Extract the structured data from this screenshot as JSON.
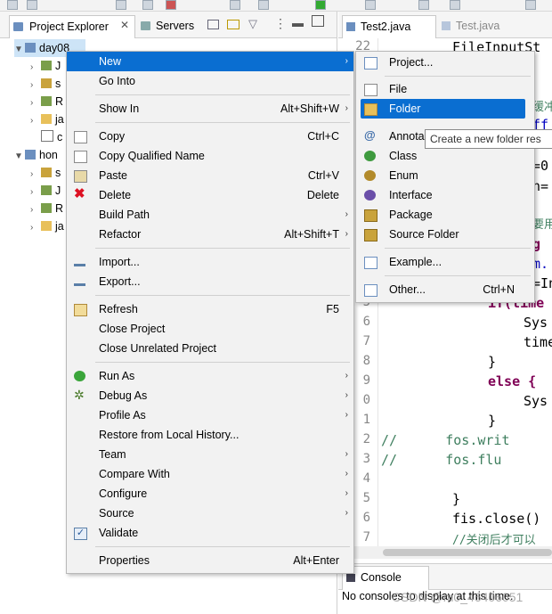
{
  "left_tabs": {
    "project_explorer": "Project Explorer",
    "servers": "Servers"
  },
  "tree": {
    "day08": "day08",
    "day08_children": [
      "J",
      "s",
      "R",
      "ja",
      "c"
    ],
    "hon": "hon",
    "hon_children": [
      "s",
      "J",
      "R",
      "ja"
    ]
  },
  "editor_tabs": {
    "active": "Test2.java",
    "inactive": "Test.java"
  },
  "editor": {
    "line_numbers": [
      "22",
      "",
      "",
      "",
      "",
      "",
      "",
      "",
      "",
      "",
      "",
      "",
      "",
      "5",
      "6",
      "7",
      "8",
      "9",
      "0",
      "1",
      "2",
      "3",
      "4",
      "5",
      "6",
      "7"
    ],
    "lines": [
      "FileInputSt",
      "",
      "缓冲",
      "ff",
      "",
      "=0",
      "n=",
      "",
      "要用",
      "g",
      "m.",
      "=In",
      "",
      "if(time",
      "Sys",
      "time",
      "}",
      "else {",
      "Sys",
      "}",
      "//      fos.writ",
      "//      fos.flu",
      "",
      "}",
      "fis.close()",
      "//关闭后才可以"
    ]
  },
  "console": {
    "tab": "Console",
    "text": "No consoles to display at this time."
  },
  "watermark": "CSDN @m0_46406051",
  "context_menu": {
    "items": [
      {
        "label": "New",
        "accel": "",
        "submenu": true,
        "icon": ""
      },
      {
        "label": "Go Into",
        "accel": "",
        "submenu": false,
        "icon": ""
      },
      {
        "label": "Show In",
        "accel": "Alt+Shift+W",
        "submenu": true,
        "icon": ""
      },
      {
        "label": "Copy",
        "accel": "Ctrl+C",
        "submenu": false,
        "icon": "copy-icon"
      },
      {
        "label": "Copy Qualified Name",
        "accel": "",
        "submenu": false,
        "icon": "copy-icon"
      },
      {
        "label": "Paste",
        "accel": "Ctrl+V",
        "submenu": false,
        "icon": "paste-icon"
      },
      {
        "label": "Delete",
        "accel": "Delete",
        "submenu": false,
        "icon": "delete-icon"
      },
      {
        "label": "Build Path",
        "accel": "",
        "submenu": true,
        "icon": ""
      },
      {
        "label": "Refactor",
        "accel": "Alt+Shift+T",
        "submenu": true,
        "icon": ""
      },
      {
        "label": "Import...",
        "accel": "",
        "submenu": false,
        "icon": "import-icon"
      },
      {
        "label": "Export...",
        "accel": "",
        "submenu": false,
        "icon": "export-icon"
      },
      {
        "label": "Refresh",
        "accel": "F5",
        "submenu": false,
        "icon": "refresh-icon"
      },
      {
        "label": "Close Project",
        "accel": "",
        "submenu": false,
        "icon": ""
      },
      {
        "label": "Close Unrelated Project",
        "accel": "",
        "submenu": false,
        "icon": ""
      },
      {
        "label": "Run As",
        "accel": "",
        "submenu": true,
        "icon": "run-icon"
      },
      {
        "label": "Debug As",
        "accel": "",
        "submenu": true,
        "icon": "debug-icon"
      },
      {
        "label": "Profile As",
        "accel": "",
        "submenu": true,
        "icon": ""
      },
      {
        "label": "Restore from Local History...",
        "accel": "",
        "submenu": false,
        "icon": ""
      },
      {
        "label": "Team",
        "accel": "",
        "submenu": true,
        "icon": ""
      },
      {
        "label": "Compare With",
        "accel": "",
        "submenu": true,
        "icon": ""
      },
      {
        "label": "Configure",
        "accel": "",
        "submenu": true,
        "icon": ""
      },
      {
        "label": "Source",
        "accel": "",
        "submenu": true,
        "icon": ""
      },
      {
        "label": "Validate",
        "accel": "",
        "submenu": false,
        "icon": "checkbox-icon"
      },
      {
        "label": "Properties",
        "accel": "Alt+Enter",
        "submenu": false,
        "icon": ""
      }
    ]
  },
  "new_submenu": {
    "items": [
      {
        "label": "Project...",
        "accel": "",
        "icon": "new-project-icon"
      },
      {
        "label": "File",
        "accel": "",
        "icon": "file-icon"
      },
      {
        "label": "Folder",
        "accel": "",
        "icon": "folder-icon"
      },
      {
        "label": "Annota",
        "accel": "",
        "icon": "annotation-icon"
      },
      {
        "label": "Class",
        "accel": "",
        "icon": "class-icon"
      },
      {
        "label": "Enum",
        "accel": "",
        "icon": "enum-icon"
      },
      {
        "label": "Interface",
        "accel": "",
        "icon": "interface-icon"
      },
      {
        "label": "Package",
        "accel": "",
        "icon": "package-icon"
      },
      {
        "label": "Source Folder",
        "accel": "",
        "icon": "source-folder-icon"
      },
      {
        "label": "Example...",
        "accel": "",
        "icon": "example-icon"
      },
      {
        "label": "Other...",
        "accel": "Ctrl+N",
        "icon": "other-icon"
      }
    ]
  },
  "tooltip": "Create a new folder res",
  "colors": {
    "highlight": "#0a6ed1",
    "keyword": "#7f0055",
    "comment": "#3f7f5f",
    "field": "#0000c0"
  }
}
